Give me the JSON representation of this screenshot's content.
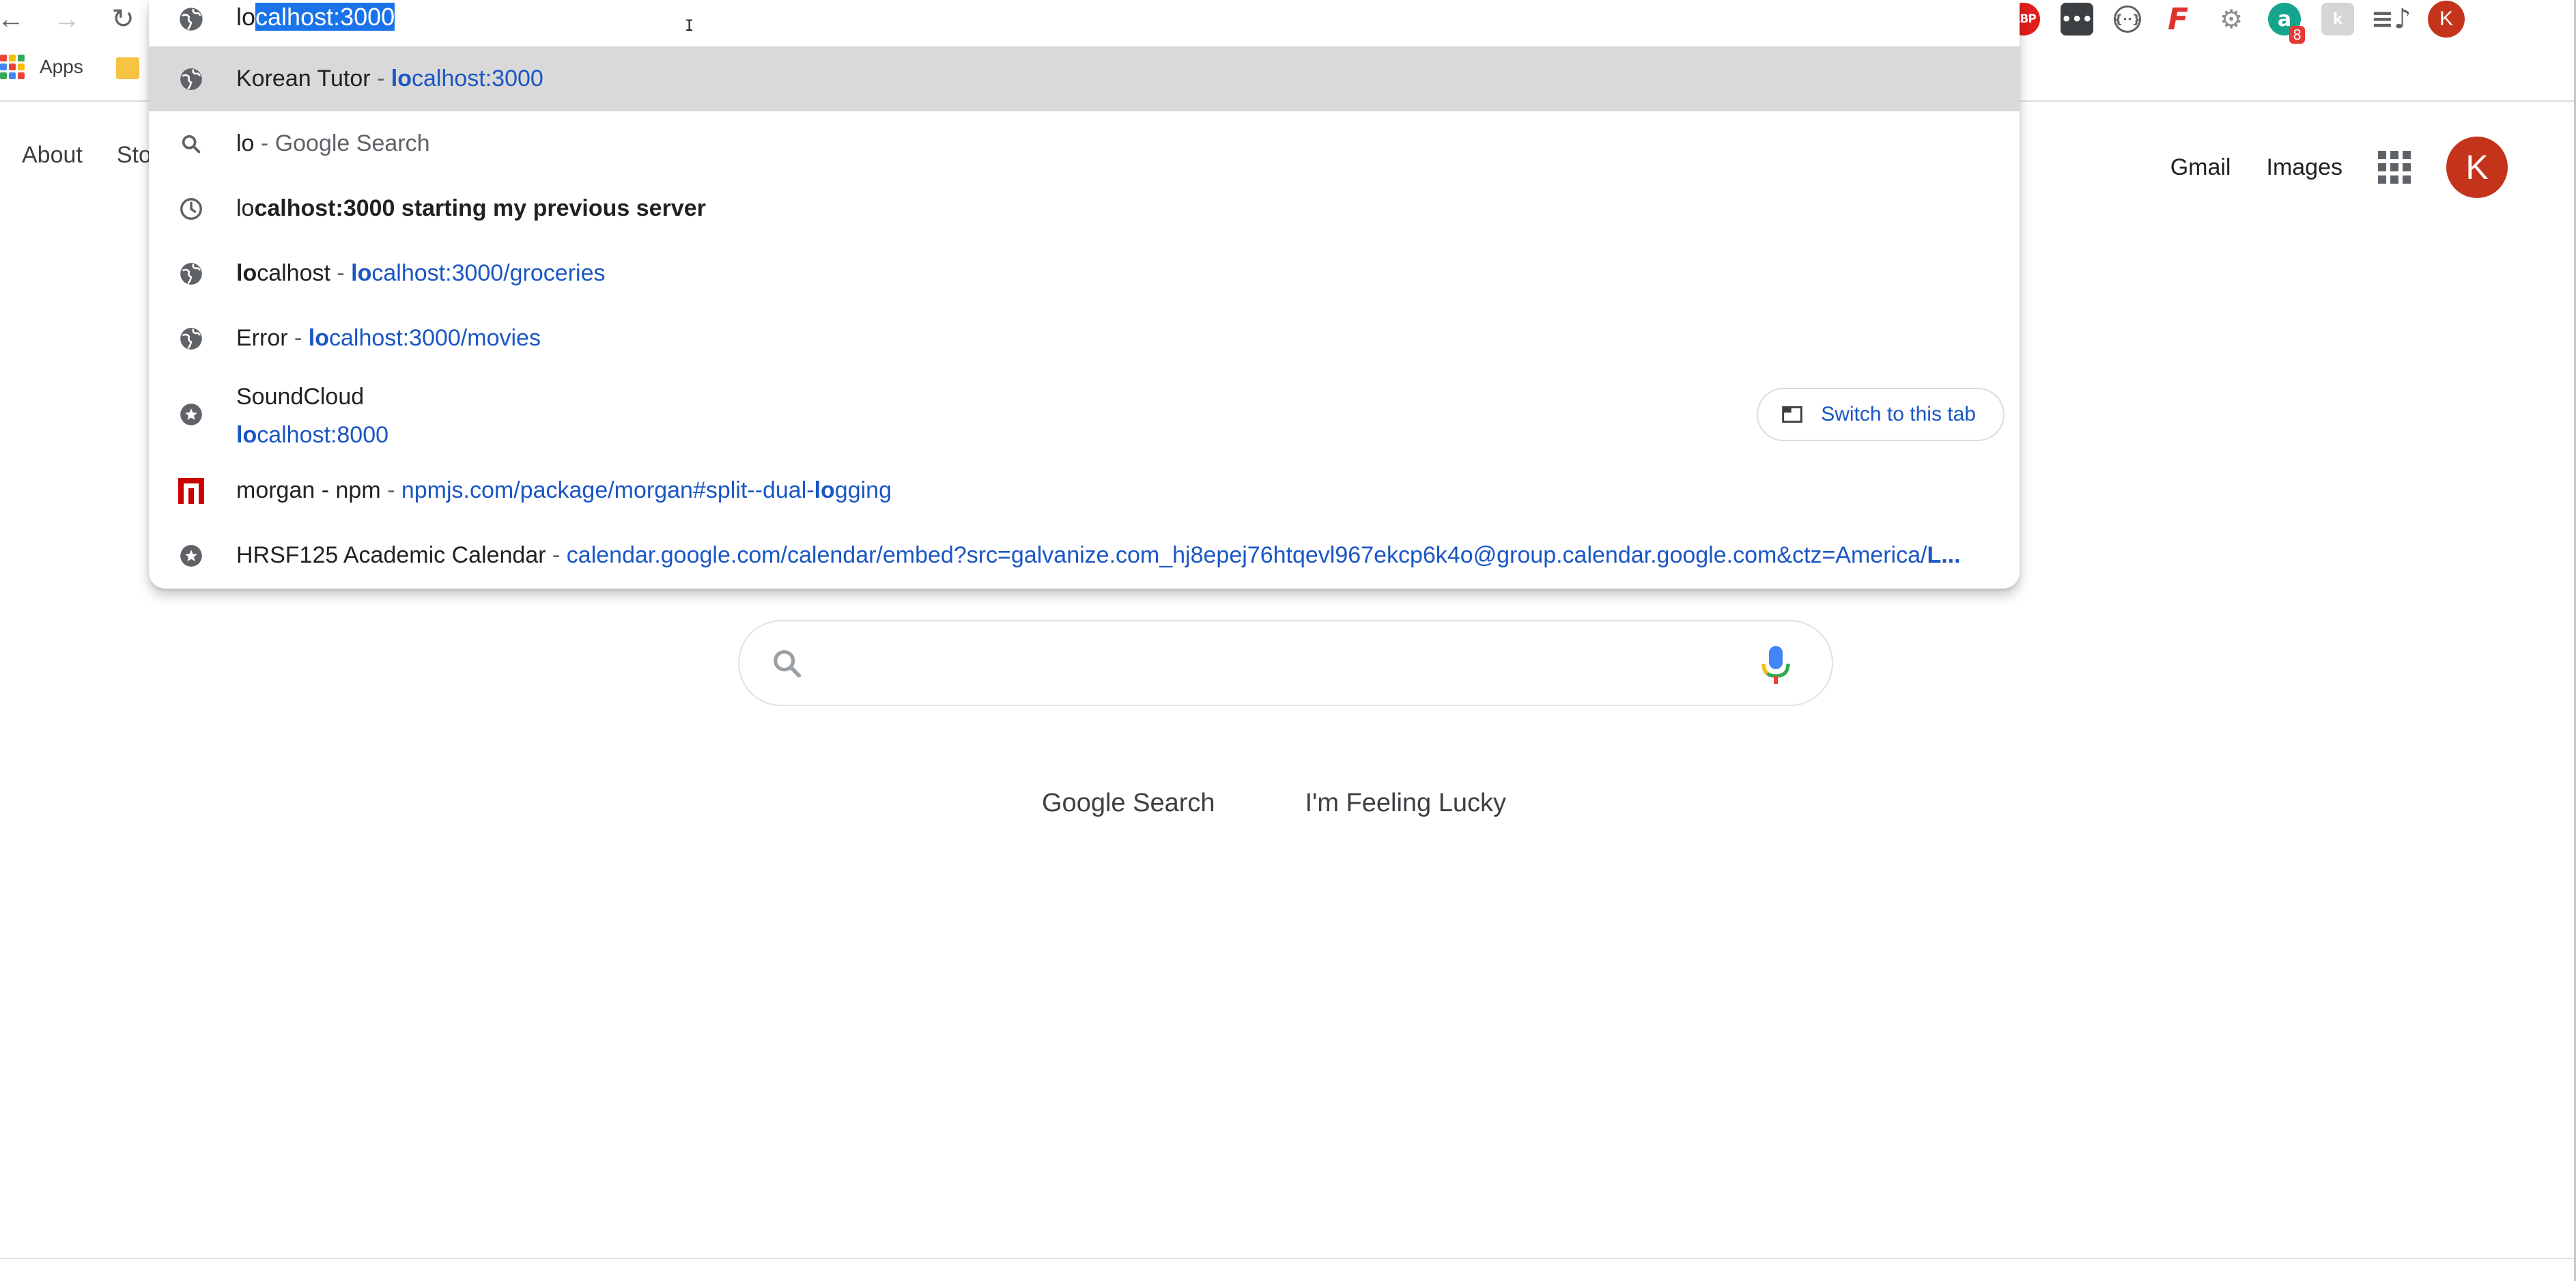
{
  "browser": {
    "back_glyph": "←",
    "forward_glyph": "→",
    "reload_glyph": "↻",
    "extensions": [
      {
        "name": "adblock-plus-icon",
        "label": "ABP"
      },
      {
        "name": "more-dots-extension-icon",
        "label": "•••"
      },
      {
        "name": "code-ring-extension-icon",
        "label": "{··}"
      },
      {
        "name": "feedly-icon",
        "label": "F"
      },
      {
        "name": "settings-extension-icon",
        "label": "⚙"
      },
      {
        "name": "grammarly-icon",
        "label": "a",
        "badge": "8"
      },
      {
        "name": "grey-extension-icon",
        "label": "k"
      },
      {
        "name": "media-queue-icon",
        "label": "≡♪"
      }
    ],
    "profile_initial": "K"
  },
  "bookmarks": {
    "apps_label": "Apps"
  },
  "omnibox": {
    "typed": "lo",
    "autocompleted_selected": "calhost:3000",
    "suggestions": [
      {
        "icon": "globe-icon",
        "title": "Korean Tutor",
        "sep": " - ",
        "url_bold": "lo",
        "url_rest": "calhost:3000"
      },
      {
        "icon": "search-icon",
        "title": "lo",
        "sep": " - ",
        "rest": "Google Search"
      },
      {
        "icon": "history-clock-icon",
        "prefix": "lo",
        "bold": "calhost:3000 starting my previous server"
      },
      {
        "icon": "globe-icon",
        "title_bold": "lo",
        "title_rest": "calhost",
        "sep": " - ",
        "url_bold": "lo",
        "url_rest": "calhost:3000/groceries"
      },
      {
        "icon": "globe-icon",
        "title": "Error",
        "sep": " - ",
        "url_bold": "lo",
        "url_rest": "calhost:3000/movies"
      },
      {
        "icon": "bookmark-star-icon",
        "title": "SoundCloud",
        "url_bold": "lo",
        "url_rest": "calhost:8000",
        "switch_label": "Switch to this tab"
      },
      {
        "icon": "npm-icon",
        "title": "morgan - npm",
        "sep": " - ",
        "url_pre": "npmjs.com/package/morgan#split--dual-",
        "url_bold": "lo",
        "url_post": "gging"
      },
      {
        "icon": "bookmark-star-icon",
        "title": "HRSF125 Academic Calendar",
        "sep": " - ",
        "url_pre": "calendar.google.com/calendar/embed?src=galvanize.com_hj8epej76htqevl967ekcp6k4o@group.calendar.google.com&ctz=America/",
        "url_bold": "L..."
      }
    ]
  },
  "google": {
    "left_links": [
      "About",
      "Sto"
    ],
    "gmail": "Gmail",
    "images": "Images",
    "profile_initial": "K",
    "search_button": "Google Search",
    "lucky_button": "I'm Feeling Lucky",
    "search_value": ""
  },
  "colors": {
    "accent_blue": "#1a73e8",
    "url_blue": "#1a56c4",
    "profile_red": "#c4341b",
    "selected_row": "#d9d9d9"
  }
}
